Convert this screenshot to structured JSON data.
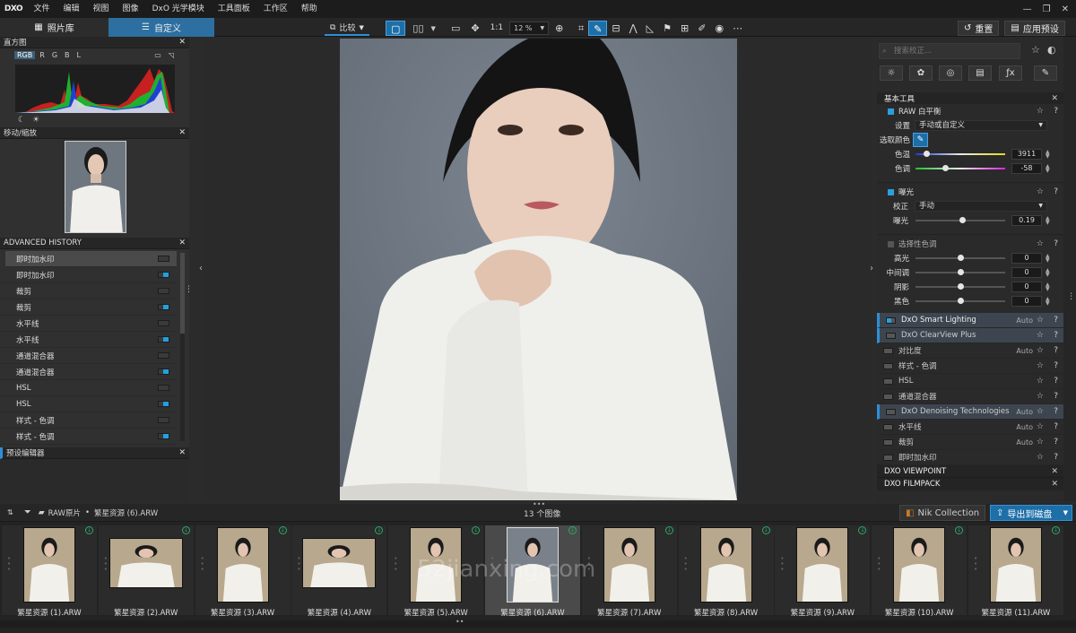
{
  "app": {
    "logo": "DXO"
  },
  "menu": [
    "文件",
    "编辑",
    "视图",
    "图像",
    "DxO 光学模块",
    "工具面板",
    "工作区",
    "帮助"
  ],
  "toolbar": {
    "tab_library": "照片库",
    "tab_customize": "自定义",
    "compare": "比较",
    "one_to_one": "1:1",
    "zoom": "12 %",
    "reset": "重置",
    "apply_preset": "应用预设"
  },
  "left": {
    "histogram_title": "直方图",
    "hist_channels": [
      "RGB",
      "R",
      "G",
      "B",
      "L"
    ],
    "navigator_title": "移动/缩放",
    "history_title": "ADVANCED HISTORY",
    "history_items": [
      {
        "label": "即时加水印",
        "on": false
      },
      {
        "label": "即时加水印",
        "on": true
      },
      {
        "label": "裁剪",
        "on": false
      },
      {
        "label": "裁剪",
        "on": true
      },
      {
        "label": "水平线",
        "on": false
      },
      {
        "label": "水平线",
        "on": true
      },
      {
        "label": "通道混合器",
        "on": false
      },
      {
        "label": "通道混合器",
        "on": true
      },
      {
        "label": "HSL",
        "on": false
      },
      {
        "label": "HSL",
        "on": true
      },
      {
        "label": "样式 - 色调",
        "on": false
      },
      {
        "label": "样式 - 色调",
        "on": true
      }
    ],
    "preset_editor_title": "预设编辑器"
  },
  "right": {
    "search_placeholder": "搜索校正...",
    "basic_tools": "基本工具",
    "wb_title": "RAW 白平衡",
    "wb_setting_label": "设置",
    "wb_setting_value": "手动或自定义",
    "wb_pick": "选取颜色",
    "temp_label": "色温",
    "temp_value": "3911",
    "temp_pos": 0.12,
    "tint_label": "色调",
    "tint_value": "-58",
    "tint_pos": 0.33,
    "exposure_title": "曝光",
    "exp_correct_label": "校正",
    "exp_correct_value": "手动",
    "exp_label": "曝光",
    "exp_value": "0.19",
    "exp_pos": 0.52,
    "selective_title": "选择性色调",
    "tones": [
      {
        "label": "高光",
        "value": "0",
        "pos": 0.5
      },
      {
        "label": "中间调",
        "value": "0",
        "pos": 0.5
      },
      {
        "label": "阴影",
        "value": "0",
        "pos": 0.5
      },
      {
        "label": "黑色",
        "value": "0",
        "pos": 0.5
      }
    ],
    "fx": [
      {
        "label": "DxO Smart Lighting",
        "auto": "Auto",
        "hl": true,
        "on": true
      },
      {
        "label": "DxO ClearView Plus",
        "auto": "",
        "hl": true,
        "on": false
      },
      {
        "label": "对比度",
        "auto": "Auto",
        "hl": false,
        "on": false
      },
      {
        "label": "样式 - 色调",
        "auto": "",
        "hl": false,
        "on": false
      },
      {
        "label": "HSL",
        "auto": "",
        "hl": false,
        "on": false
      },
      {
        "label": "通道混合器",
        "auto": "",
        "hl": false,
        "on": false
      },
      {
        "label": "DxO Denoising Technologies",
        "auto": "Auto",
        "hl": true,
        "on": false
      },
      {
        "label": "水平线",
        "auto": "Auto",
        "hl": false,
        "on": false
      },
      {
        "label": "裁剪",
        "auto": "Auto",
        "hl": false,
        "on": false
      },
      {
        "label": "即时加水印",
        "auto": "",
        "hl": false,
        "on": false
      }
    ],
    "viewpoint": "DXO VIEWPOINT",
    "filmpack": "DXO FILMPACK"
  },
  "filmstrip": {
    "folder": "RAW原片",
    "current": "繁星资源 (6).ARW",
    "count": "13 个图像",
    "nik": "Nik Collection",
    "export": "导出到磁盘",
    "watermark": "52jianxing.com",
    "items": [
      "繁星资源 (1).ARW",
      "繁星资源 (2).ARW",
      "繁星资源 (3).ARW",
      "繁星资源 (4).ARW",
      "繁星资源 (5).ARW",
      "繁星资源 (6).ARW",
      "繁星资源 (7).ARW",
      "繁星资源 (8).ARW",
      "繁星资源 (9).ARW",
      "繁星资源 (10).ARW",
      "繁星资源 (11).ARW"
    ],
    "selected_index": 5
  },
  "colors": {
    "accent": "#2d8fd6",
    "toggle_on": "#22a0e0"
  }
}
